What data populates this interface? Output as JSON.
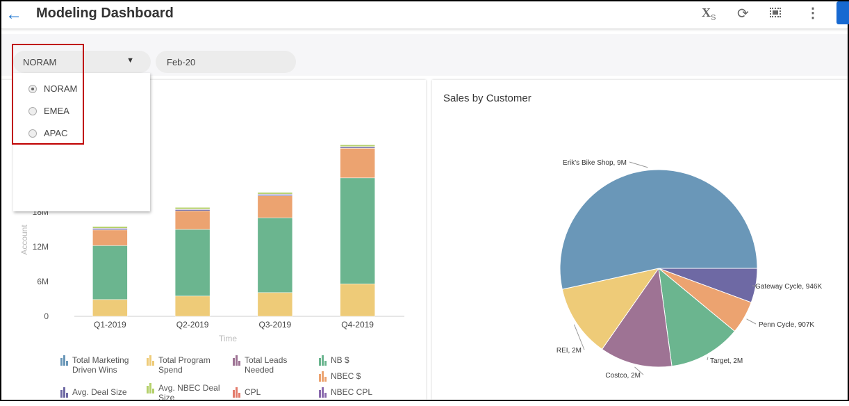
{
  "header": {
    "title": "Modeling Dashboard",
    "back_icon": "arrow-left-icon",
    "actions": [
      {
        "icon": "formula-xs-icon",
        "label": "X",
        "sub": "S"
      },
      {
        "icon": "refresh-icon"
      },
      {
        "icon": "fullscreen-icon"
      },
      {
        "icon": "more-vertical-icon"
      }
    ]
  },
  "filters": {
    "region": {
      "value": "NORAM",
      "options": [
        {
          "label": "NORAM",
          "selected": true
        },
        {
          "label": "EMEA",
          "selected": false
        },
        {
          "label": "APAC",
          "selected": false
        }
      ]
    },
    "period": {
      "value": "Feb-20"
    }
  },
  "colors": {
    "accent": "#1e76d2",
    "highlight": "#c00000"
  },
  "chart_data": [
    {
      "type": "bar",
      "stacked": true,
      "xlabel": "Time",
      "ylabel": "Account",
      "categories": [
        "Q1-2019",
        "Q2-2019",
        "Q3-2019",
        "Q4-2019"
      ],
      "yticks": [
        "0",
        "6M",
        "12M",
        "18M"
      ],
      "ylim": [
        0,
        30000000
      ],
      "legend_placement": "bottom",
      "series": [
        {
          "name": "Total Marketing Driven Wins",
          "color": "#6a97b8",
          "values": [
            0,
            0,
            0,
            0
          ]
        },
        {
          "name": "Total Program Spend",
          "color": "#eecb78",
          "values": [
            2900000,
            3500000,
            4100000,
            5600000
          ]
        },
        {
          "name": "Total Leads Needed",
          "color": "#9e7394",
          "values": [
            0,
            0,
            0,
            0
          ]
        },
        {
          "name": "NB $",
          "color": "#6bb58f",
          "values": [
            9300000,
            11500000,
            12900000,
            18300000
          ]
        },
        {
          "name": "NBEC $",
          "color": "#eca370",
          "values": [
            2700000,
            3200000,
            3800000,
            5100000
          ]
        },
        {
          "name": "Avg. Deal Size",
          "color": "#6e69a4",
          "values": [
            200000,
            200000,
            200000,
            200000
          ]
        },
        {
          "name": "CPL",
          "color": "#e37c6c",
          "values": [
            0,
            0,
            0,
            0
          ]
        },
        {
          "name": "NBEC CPL",
          "color": "#8a6aae",
          "values": [
            100000,
            100000,
            100000,
            100000
          ]
        },
        {
          "name": "Avg. NBEC Deal Size",
          "color": "#b4d06a",
          "values": [
            300000,
            300000,
            300000,
            300000
          ]
        }
      ]
    },
    {
      "type": "pie",
      "title": "Sales by Customer",
      "slices": [
        {
          "label": "Gateway Cycle, 946K",
          "value": 946000,
          "color": "#6e69a4"
        },
        {
          "label": "Penn Cycle, 907K",
          "value": 907000,
          "color": "#eca370"
        },
        {
          "label": "Target, 2M",
          "value": 2000000,
          "color": "#6bb58f"
        },
        {
          "label": "Costco, 2M",
          "value": 2000000,
          "color": "#9e7394"
        },
        {
          "label": "REI, 2M",
          "value": 2000000,
          "color": "#eecb78"
        },
        {
          "label": "Erik's Bike Shop, 9M",
          "value": 9000000,
          "color": "#6a97b8"
        }
      ]
    }
  ]
}
